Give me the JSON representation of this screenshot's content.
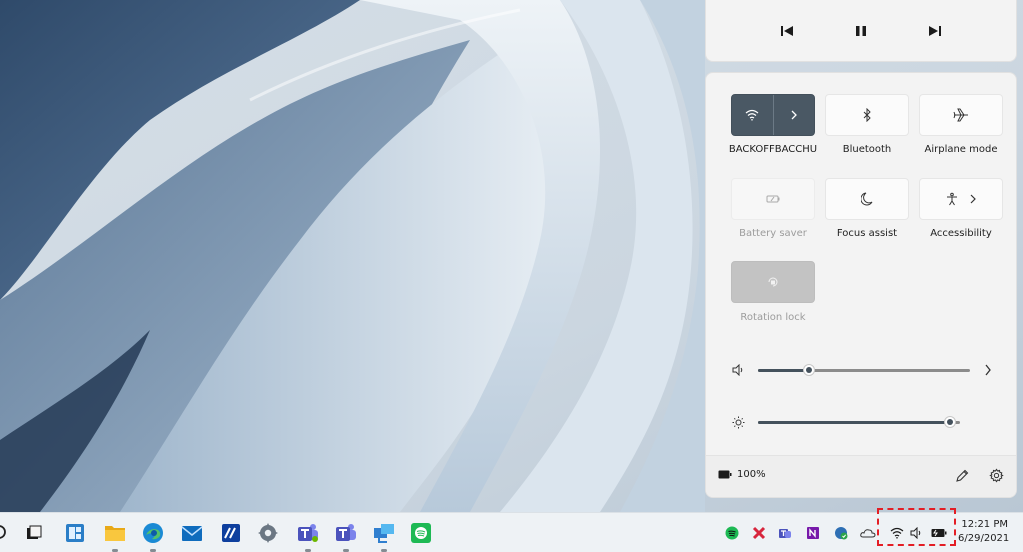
{
  "media": {
    "prev_icon": "previous-track-icon",
    "pause_icon": "pause-icon",
    "next_icon": "next-track-icon"
  },
  "quick_settings": {
    "tiles": [
      {
        "label": "BACKOFFBACCHU",
        "icon": "wifi-icon",
        "state": "on",
        "has_chevron": true
      },
      {
        "label": "Bluetooth",
        "icon": "bluetooth-icon",
        "state": "off"
      },
      {
        "label": "Airplane mode",
        "icon": "airplane-icon",
        "state": "off"
      },
      {
        "label": "Battery saver",
        "icon": "battery-saver-icon",
        "state": "disabled"
      },
      {
        "label": "Focus assist",
        "icon": "moon-icon",
        "state": "off"
      },
      {
        "label": "Accessibility",
        "icon": "accessibility-icon",
        "state": "off",
        "has_chevron": true
      },
      {
        "label": "Rotation lock",
        "icon": "rotation-lock-icon",
        "state": "disabled"
      }
    ],
    "volume": {
      "icon": "speaker-icon",
      "level_percent": 24
    },
    "brightness": {
      "icon": "brightness-icon",
      "level_percent": 95
    },
    "battery": {
      "icon": "battery-icon",
      "text": "100%"
    },
    "edit_icon": "pencil-icon",
    "settings_icon": "gear-icon"
  },
  "taskbar": {
    "apps": [
      "search-icon",
      "task-view-icon",
      "widgets-icon",
      "file-explorer-icon",
      "edge-icon",
      "mail-icon",
      "stock-app-icon",
      "settings-icon",
      "teams-icon",
      "teams-icon",
      "remote-desktop-icon",
      "spotify-icon"
    ],
    "tray": [
      "spotify-tray-icon",
      "xbox-tray-icon",
      "teams-tray-icon",
      "onenote-tray-icon",
      "defender-tray-icon",
      "onedrive-tray-icon",
      "wifi-icon",
      "speaker-icon",
      "battery-icon"
    ],
    "time": "12:21 PM",
    "date": "6/29/2021"
  },
  "colors": {
    "accent": "#4a5864",
    "highlight": "#e31e25"
  }
}
